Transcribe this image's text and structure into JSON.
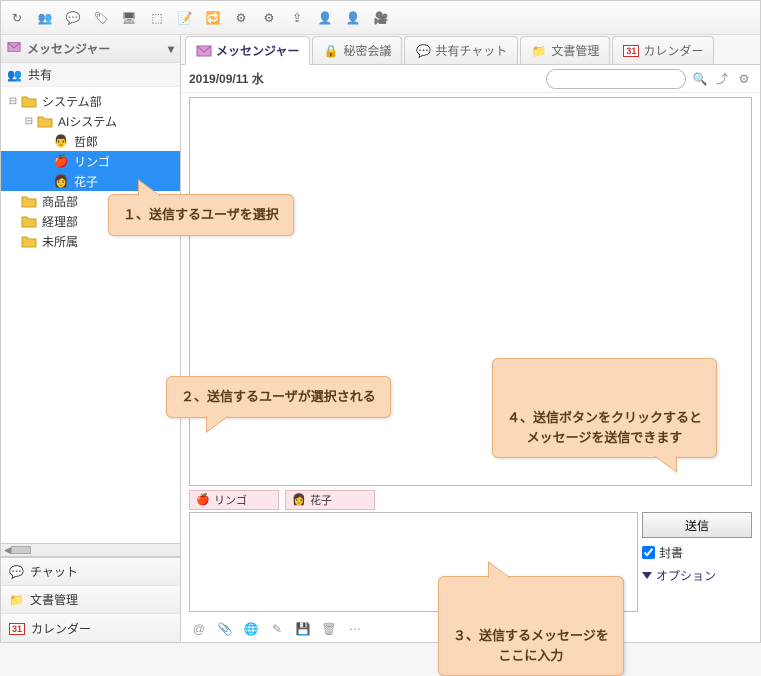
{
  "toolbar_icons": [
    "refresh",
    "group",
    "chat-bubble",
    "tag",
    "present",
    "marquee",
    "compose",
    "sync",
    "gear1",
    "gear2",
    "upload",
    "person-add",
    "person-gear",
    "video"
  ],
  "sidebar": {
    "header": "メッセンジャー",
    "share_label": "共有",
    "tree": [
      {
        "indent": 0,
        "toggle": "-",
        "type": "folder",
        "label": "システム部"
      },
      {
        "indent": 1,
        "toggle": "-",
        "type": "folder",
        "label": "AIシステム"
      },
      {
        "indent": 2,
        "toggle": "",
        "type": "user",
        "icon": "avatar-m",
        "label": "哲郎"
      },
      {
        "indent": 2,
        "toggle": "",
        "type": "user",
        "icon": "apple",
        "label": "リンゴ",
        "selected": true
      },
      {
        "indent": 2,
        "toggle": "",
        "type": "user",
        "icon": "avatar-f",
        "label": "花子",
        "selected": true
      },
      {
        "indent": 0,
        "toggle": "",
        "type": "folder",
        "label": "商品部"
      },
      {
        "indent": 0,
        "toggle": "",
        "type": "folder",
        "label": "経理部"
      },
      {
        "indent": 0,
        "toggle": "",
        "type": "folder",
        "label": "未所属"
      }
    ],
    "nav": [
      {
        "icon": "chat",
        "label": "チャット"
      },
      {
        "icon": "doc",
        "label": "文書管理"
      },
      {
        "icon": "cal",
        "label": "カレンダー"
      }
    ]
  },
  "tabs": [
    {
      "icon": "mail",
      "label": "メッセンジャー",
      "active": true
    },
    {
      "icon": "lock",
      "label": "秘密会議"
    },
    {
      "icon": "chat",
      "label": "共有チャット"
    },
    {
      "icon": "doc",
      "label": "文書管理"
    },
    {
      "icon": "cal",
      "label": "カレンダー"
    }
  ],
  "date": "2019/09/11 水",
  "search_placeholder": "",
  "recipients": [
    {
      "icon": "apple",
      "label": "リンゴ"
    },
    {
      "icon": "avatar-f",
      "label": "花子"
    }
  ],
  "compose": {
    "send": "送信",
    "sealed": "封書",
    "options": "オプション"
  },
  "compose_toolbar": [
    "at",
    "clip",
    "globe",
    "edit",
    "save",
    "trash",
    "more"
  ],
  "callouts": {
    "c1": "１、送信するユーザを選択",
    "c2": "２、送信するユーザが選択される",
    "c3": "３、送信するメッセージを\nここに入力",
    "c4": "４、送信ボタンをクリックすると\nメッセージを送信できます"
  }
}
